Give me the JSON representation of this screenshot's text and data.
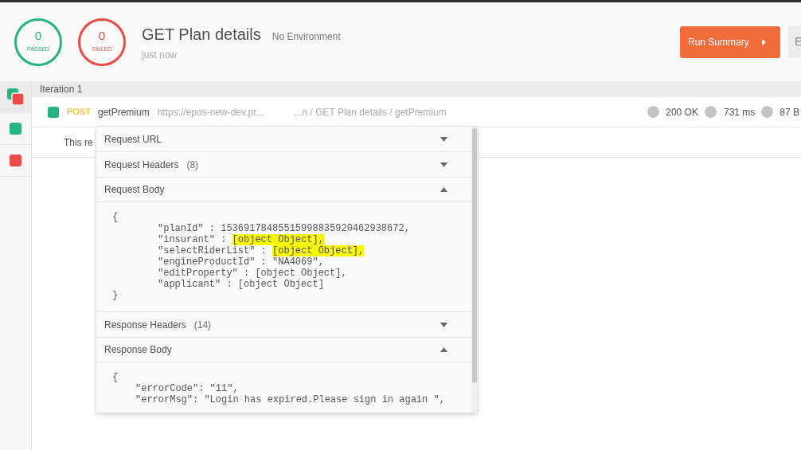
{
  "summary": {
    "passed": {
      "count": "0",
      "label": "PASSED"
    },
    "failed": {
      "count": "0",
      "label": "FAILED"
    }
  },
  "run": {
    "title": "GET Plan details",
    "environment": "No Environment",
    "time": "just now"
  },
  "buttons": [
    {
      "label": "Run Summary",
      "kind": "primary"
    },
    {
      "label": "E",
      "kind": "secondary"
    }
  ],
  "sidebar": {
    "items": [
      {
        "kind": "mixed",
        "selected": true
      },
      {
        "kind": "passed",
        "selected": false
      },
      {
        "kind": "failed",
        "selected": false
      }
    ]
  },
  "iteration": {
    "title": "Iteration 1"
  },
  "request": {
    "method": "POST",
    "name": "getPremium",
    "url": "https://epos-new-dev.pr...",
    "path": "...n / GET Plan details / getPremium",
    "status": "200 OK",
    "duration": "731 ms",
    "size": "87 B",
    "note": "This re"
  },
  "popup": {
    "sections": [
      {
        "title": "Request URL",
        "expanded": false
      },
      {
        "title": "Request Headers",
        "count": "(8)",
        "expanded": false
      },
      {
        "title": "Request Body",
        "expanded": true,
        "kind": "request-body",
        "open": "{",
        "close": "}",
        "entries": [
          {
            "key": "\"planId\" : ",
            "value": "15369178485515998835920462938672,",
            "highlighted": false
          },
          {
            "key": "\"insurant\" : ",
            "value": "[object Object],",
            "highlighted": true
          },
          {
            "key": "\"selectRiderList\" : ",
            "value": "[object Object],",
            "highlighted": true
          },
          {
            "key": "\"engineProductId\" : ",
            "value": "\"NA4069\",",
            "highlighted": false
          },
          {
            "key": "\"editProperty\" : ",
            "value": "[object Object],",
            "highlighted": false
          },
          {
            "key": "\"applicant\" : ",
            "value": "[object Object]",
            "highlighted": false
          }
        ]
      },
      {
        "title": "Response Headers",
        "count": "(14)",
        "expanded": false
      },
      {
        "title": "Response Body",
        "expanded": true,
        "kind": "response-body",
        "open": "{",
        "entries": [
          {
            "key": "\"errorCode\": ",
            "value": "\"11\",",
            "highlighted": false
          },
          {
            "key": "\"errorMsg\": ",
            "value": "\"Login has expired.Please sign in again \",",
            "highlighted": false
          }
        ]
      }
    ]
  }
}
